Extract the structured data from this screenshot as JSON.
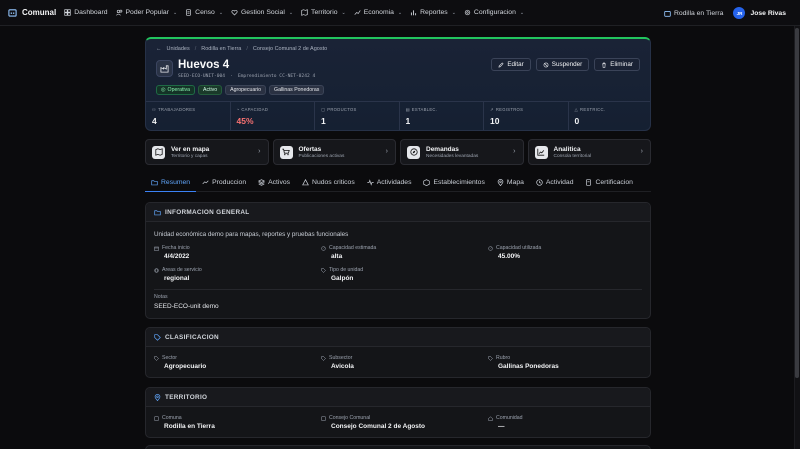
{
  "nav": {
    "brand": "Comunal",
    "items": [
      {
        "label": "Dashboard",
        "icon": "dashboard-icon",
        "caret": false
      },
      {
        "label": "Poder Popular",
        "icon": "people-icon",
        "caret": true
      },
      {
        "label": "Censo",
        "icon": "census-icon",
        "caret": true
      },
      {
        "label": "Gestion Social",
        "icon": "social-icon",
        "caret": true
      },
      {
        "label": "Territorio",
        "icon": "map-icon",
        "caret": true
      },
      {
        "label": "Economia",
        "icon": "economy-icon",
        "caret": true
      },
      {
        "label": "Reportes",
        "icon": "report-icon",
        "caret": true
      },
      {
        "label": "Configuracion",
        "icon": "gear-icon",
        "caret": true
      }
    ],
    "location": "Rodilla en Tierra",
    "user_initials": "JR",
    "user_name": "Jose Rivas"
  },
  "hero": {
    "breadcrumbs": [
      "Unidades",
      "Rodilla en Tierra",
      "Consejo Comunal 2 de Agosto"
    ],
    "title": "Huevos 4",
    "code": "SEED-ECO-UNIT-004",
    "meta": "Emprendimiento CC-NET-0242 4",
    "badges": [
      "Operativa",
      "Activo",
      "Agropecuario",
      "Gallinas Ponedoras"
    ],
    "actions": {
      "edit": "Editar",
      "suspend": "Suspender",
      "delete": "Eliminar"
    },
    "stats": [
      {
        "label": "TRABAJADORES",
        "value": "4"
      },
      {
        "label": "CAPACIDAD",
        "value": "45%"
      },
      {
        "label": "PRODUCTOS",
        "value": "1"
      },
      {
        "label": "ESTABLEC.",
        "value": "1"
      },
      {
        "label": "REGISTROS",
        "value": "10"
      },
      {
        "label": "RESTRICC.",
        "value": "0"
      }
    ]
  },
  "quick": [
    {
      "title": "Ver en mapa",
      "sub": "Territorio y capas"
    },
    {
      "title": "Ofertas",
      "sub": "Publicaciones activas"
    },
    {
      "title": "Demandas",
      "sub": "Necesidades levantadas"
    },
    {
      "title": "Analitica",
      "sub": "Consola territorial"
    }
  ],
  "tabs": [
    "Resumen",
    "Produccion",
    "Activos",
    "Nudos criticos",
    "Actividades",
    "Establecimientos",
    "Mapa",
    "Actividad",
    "Certificacion"
  ],
  "info": {
    "title": "INFORMACION GENERAL",
    "description": "Unidad económica demo para mapas, reportes y pruebas funcionales",
    "fields": [
      {
        "label": "Fecha inicio",
        "value": "4/4/2022"
      },
      {
        "label": "Capacidad estimada",
        "value": "alta"
      },
      {
        "label": "Capacidad utilizada",
        "value": "45.00%"
      },
      {
        "label": "Areas de servicio",
        "value": "regional"
      },
      {
        "label": "Tipo de unidad",
        "value": "Galpón"
      }
    ],
    "notes_label": "Notas",
    "notes_value": "SEED-ECO-unit demo"
  },
  "clasificacion": {
    "title": "CLASIFICACION",
    "fields": [
      {
        "label": "Sector",
        "value": "Agropecuario"
      },
      {
        "label": "Subsector",
        "value": "Avicola"
      },
      {
        "label": "Rubro",
        "value": "Gallinas Ponedoras"
      }
    ]
  },
  "territorio": {
    "title": "TERRITORIO",
    "fields": [
      {
        "label": "Comuna",
        "value": "Rodilla en Tierra"
      },
      {
        "label": "Consejo Comunal",
        "value": "Consejo Comunal 2 de Agosto"
      },
      {
        "label": "Comunidad",
        "value": "—"
      }
    ]
  }
}
